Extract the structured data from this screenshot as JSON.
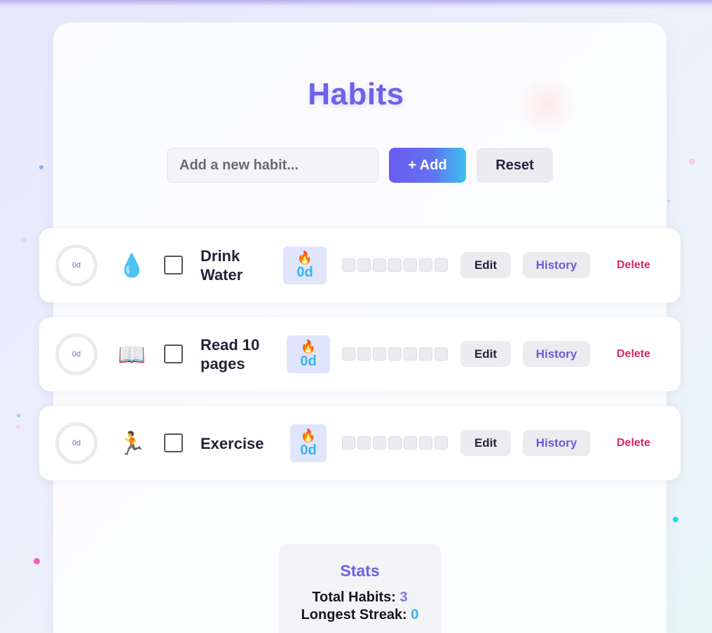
{
  "header": {
    "title": "Habits"
  },
  "add_form": {
    "placeholder": "Add a new habit...",
    "add_label": "+ Add",
    "reset_label": "Reset"
  },
  "habits": [
    {
      "name": "Drink Water",
      "icon": "water-drop-icon",
      "emoji": "💧",
      "ring_label": "0d",
      "streak": "0d",
      "checked": false,
      "progress": 0
    },
    {
      "name": "Read 10 pages",
      "icon": "book-icon",
      "emoji": "📖",
      "ring_label": "0d",
      "streak": "0d",
      "checked": false,
      "progress": 0
    },
    {
      "name": "Exercise",
      "icon": "runner-icon",
      "emoji": "🏃",
      "ring_label": "0d",
      "streak": "0d",
      "checked": false,
      "progress": 0
    }
  ],
  "row_actions": {
    "edit": "Edit",
    "history": "History",
    "delete": "Delete"
  },
  "stats": {
    "title": "Stats",
    "total_label": "Total Habits:",
    "total_value": "3",
    "longest_label": "Longest Streak:",
    "longest_value": "0"
  },
  "colors": {
    "accent": "#6c63e6",
    "streak": "#39b4ee",
    "danger": "#d02a6a"
  }
}
